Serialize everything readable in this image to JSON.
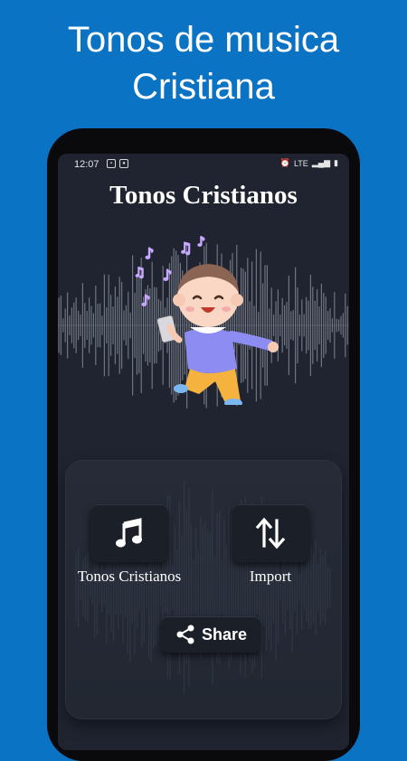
{
  "promo": {
    "headline_line1": "Tonos de musica",
    "headline_line2": "Cristiana"
  },
  "status_bar": {
    "time": "12:07",
    "network": "LTE"
  },
  "app": {
    "title": "Tonos Cristianos"
  },
  "actions": {
    "tones_label": "Tonos Cristianos",
    "import_label": "Import",
    "share_label": "Share"
  },
  "colors": {
    "background": "#0b73c4",
    "screen": "#1f2430",
    "text": "#ffffff"
  },
  "icons": {
    "tones": "music-note-icon",
    "import": "up-down-arrows-icon",
    "share": "share-icon"
  }
}
